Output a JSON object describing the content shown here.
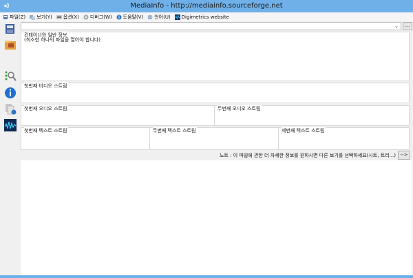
{
  "window": {
    "title": "MediaInfo - http://mediainfo.sourceforge.net"
  },
  "menu": {
    "items": [
      {
        "label": "파일(Z)",
        "icon": "file-icon"
      },
      {
        "label": "보기(Y)",
        "icon": "view-icon"
      },
      {
        "label": "옵션(X)",
        "icon": "options-icon"
      },
      {
        "label": "디버그(W)",
        "icon": "debug-icon"
      },
      {
        "label": "도움말(V)",
        "icon": "help-icon"
      },
      {
        "label": "언어(U)",
        "icon": "globe-icon"
      },
      {
        "label": "Digimetrics website",
        "icon": "digimetrics-icon"
      }
    ]
  },
  "toolbar": {
    "combo_arrow": "⌄",
    "more_label": "..."
  },
  "panels": {
    "general": {
      "title": "컨테이너와 일반 정보",
      "body": "(최소한 하나의 파일을 열어야 합니다)"
    },
    "video1": {
      "title": "첫번째 비디오 스트림"
    },
    "audio1": {
      "title": "첫번째 오디오 스트림"
    },
    "audio2": {
      "title": "두번째 오디오 스트림"
    },
    "text1": {
      "title": "첫번째 텍스트 스트림"
    },
    "text2": {
      "title": "두번째 텍스트 스트림"
    },
    "text3": {
      "title": "세번째 텍스트 스트림"
    }
  },
  "note": {
    "text": "노트 : 이 파일에 관한 더 자세한 정보를 원하시면 다른 보기를 선택하세요(시트, 트리...)",
    "button_label": "-->"
  },
  "colors": {
    "titlebar": "#6fb0e8",
    "panel_border": "#d8d8d8",
    "client_bg": "#f0f0f0"
  }
}
